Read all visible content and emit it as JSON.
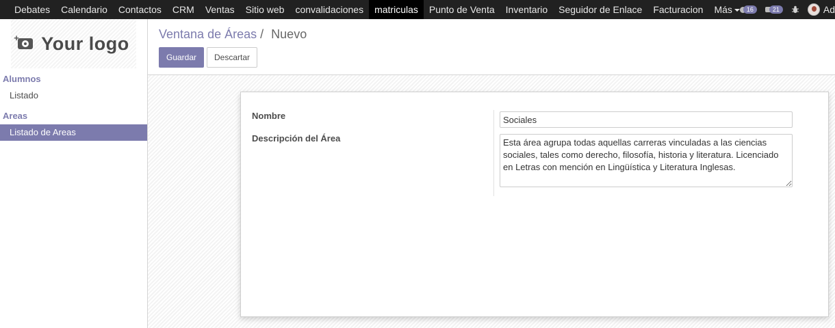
{
  "topbar": {
    "menu": [
      {
        "label": "Debates",
        "active": false
      },
      {
        "label": "Calendario",
        "active": false
      },
      {
        "label": "Contactos",
        "active": false
      },
      {
        "label": "CRM",
        "active": false
      },
      {
        "label": "Ventas",
        "active": false
      },
      {
        "label": "Sitio web",
        "active": false
      },
      {
        "label": "convalidaciones",
        "active": false
      },
      {
        "label": "matriculas",
        "active": true
      },
      {
        "label": "Punto de Venta",
        "active": false
      },
      {
        "label": "Inventario",
        "active": false
      },
      {
        "label": "Seguidor de Enlace",
        "active": false
      },
      {
        "label": "Facturacion",
        "active": false
      }
    ],
    "more_label": "Más",
    "activities_count": "16",
    "messages_count": "21",
    "debug_icon": "bug-icon",
    "user_label": "Ad"
  },
  "sidebar": {
    "logo_text": "Your logo",
    "sections": [
      {
        "title": "Alumnos",
        "items": [
          {
            "label": "Listado",
            "active": false
          }
        ]
      },
      {
        "title": "Areas",
        "items": [
          {
            "label": "Listado de Areas",
            "active": true
          }
        ]
      }
    ]
  },
  "control": {
    "breadcrumb_parent": "Ventana de Áreas",
    "breadcrumb_sep": "/",
    "breadcrumb_current": "Nuevo",
    "save_label": "Guardar",
    "discard_label": "Descartar"
  },
  "form": {
    "nombre_label": "Nombre",
    "nombre_value": "Sociales",
    "descripcion_label": "Descripción del Área",
    "descripcion_value": "Esta área agrupa todas aquellas carreras vinculadas a las ciencias sociales, tales como derecho, filosofía, historia y literatura. Licenciado en Letras con mención en Lingüística y Literatura Inglesas."
  },
  "colors": {
    "accent": "#7c7bad",
    "navbar": "#212121",
    "navbar_active": "#000000"
  }
}
